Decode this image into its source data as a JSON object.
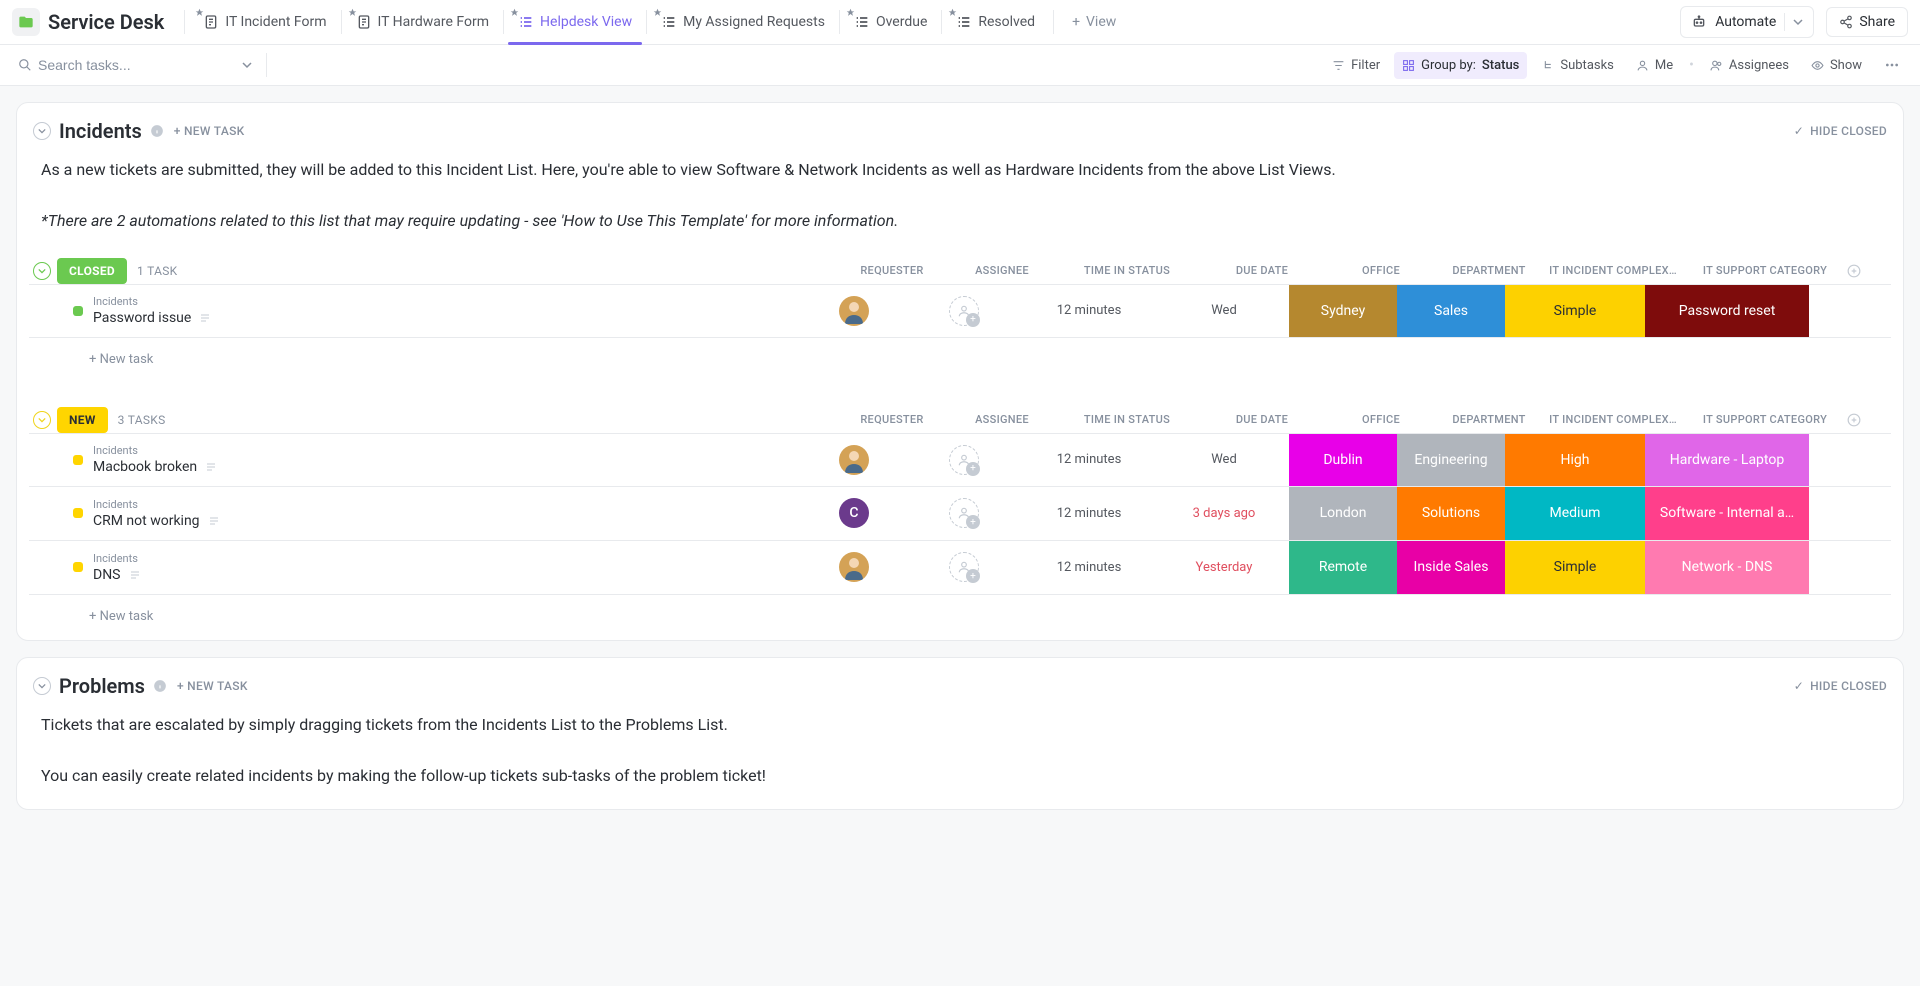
{
  "project": {
    "title": "Service Desk"
  },
  "tabs": [
    {
      "label": "IT Incident Form",
      "type": "form"
    },
    {
      "label": "IT Hardware Form",
      "type": "form"
    },
    {
      "label": "Helpdesk View",
      "type": "list",
      "active": true
    },
    {
      "label": "My Assigned Requests",
      "type": "list"
    },
    {
      "label": "Overdue",
      "type": "list"
    },
    {
      "label": "Resolved",
      "type": "list"
    }
  ],
  "addView": {
    "label": "View"
  },
  "topbar": {
    "automate": "Automate",
    "share": "Share"
  },
  "toolbar": {
    "searchPlaceholder": "Search tasks...",
    "filter": "Filter",
    "groupByLabel": "Group by:",
    "groupByValue": "Status",
    "subtasks": "Subtasks",
    "me": "Me",
    "assignees": "Assignees",
    "show": "Show"
  },
  "sections": {
    "incidents": {
      "title": "Incidents",
      "newTask": "+ NEW TASK",
      "hideClosed": "HIDE CLOSED",
      "descLine1": "As a new tickets are submitted, they will be added to this Incident List. Here, you're able to view Software & Network Incidents as well as Hardware Incidents from the above List Views.",
      "descLine2": "*There are 2 automations related to this list that may require updating - see 'How to Use This Template' for more information."
    },
    "problems": {
      "title": "Problems",
      "newTask": "+ NEW TASK",
      "hideClosed": "HIDE CLOSED",
      "descLine1": "Tickets that are escalated by simply dragging tickets from the Incidents List to the Problems List.",
      "descLine2": "You can easily create related incidents by making the follow-up tickets sub-tasks of the problem ticket!"
    }
  },
  "columns": {
    "requester": "REQUESTER",
    "assignee": "ASSIGNEE",
    "timeInStatus": "TIME IN STATUS",
    "dueDate": "DUE DATE",
    "office": "OFFICE",
    "department": "DEPARTMENT",
    "complexity": "IT INCIDENT COMPLEX…",
    "category": "IT SUPPORT CATEGORY"
  },
  "groups": {
    "closed": {
      "label": "CLOSED",
      "count": "1 TASK"
    },
    "new": {
      "label": "NEW",
      "count": "3 TASKS"
    }
  },
  "newTaskRow": "+ New task",
  "tasks": {
    "closed": [
      {
        "breadcrumb": "Incidents",
        "name": "Password issue",
        "requester": {
          "type": "avatar",
          "color": "#d4a256"
        },
        "timeInStatus": "12 minutes",
        "dueDate": "Wed",
        "office": {
          "text": "Sydney",
          "bg": "#b5882f"
        },
        "department": {
          "text": "Sales",
          "bg": "#2e8fd8"
        },
        "complexity": {
          "text": "Simple",
          "bg": "#fdd100",
          "fg": "#2a2e34"
        },
        "category": {
          "text": "Password reset",
          "bg": "#7e0c0c"
        }
      }
    ],
    "new": [
      {
        "breadcrumb": "Incidents",
        "name": "Macbook broken",
        "requester": {
          "type": "avatar",
          "color": "#d4a256"
        },
        "timeInStatus": "12 minutes",
        "dueDate": "Wed",
        "office": {
          "text": "Dublin",
          "bg": "#e800e8"
        },
        "department": {
          "text": "Engineering",
          "bg": "#b0b5bc"
        },
        "complexity": {
          "text": "High",
          "bg": "#ff7a00"
        },
        "category": {
          "text": "Hardware - Laptop",
          "bg": "#e066e8"
        }
      },
      {
        "breadcrumb": "Incidents",
        "name": "CRM not working",
        "requester": {
          "type": "letter",
          "letter": "C",
          "color": "#6b3a8c"
        },
        "timeInStatus": "12 minutes",
        "dueDate": "3 days ago",
        "dueOverdue": true,
        "office": {
          "text": "London",
          "bg": "#b0b5bc"
        },
        "department": {
          "text": "Solutions",
          "bg": "#ff7a00"
        },
        "complexity": {
          "text": "Medium",
          "bg": "#00b8c4"
        },
        "category": {
          "text": "Software - Internal a…",
          "bg": "#ff3f8b"
        }
      },
      {
        "breadcrumb": "Incidents",
        "name": "DNS",
        "requester": {
          "type": "avatar",
          "color": "#d4a256"
        },
        "timeInStatus": "12 minutes",
        "dueDate": "Yesterday",
        "dueOverdue": true,
        "office": {
          "text": "Remote",
          "bg": "#2eb88a"
        },
        "department": {
          "text": "Inside Sales",
          "bg": "#e800a6"
        },
        "complexity": {
          "text": "Simple",
          "bg": "#fdd100",
          "fg": "#2a2e34"
        },
        "category": {
          "text": "Network - DNS",
          "bg": "#ff7ab0"
        }
      }
    ]
  }
}
